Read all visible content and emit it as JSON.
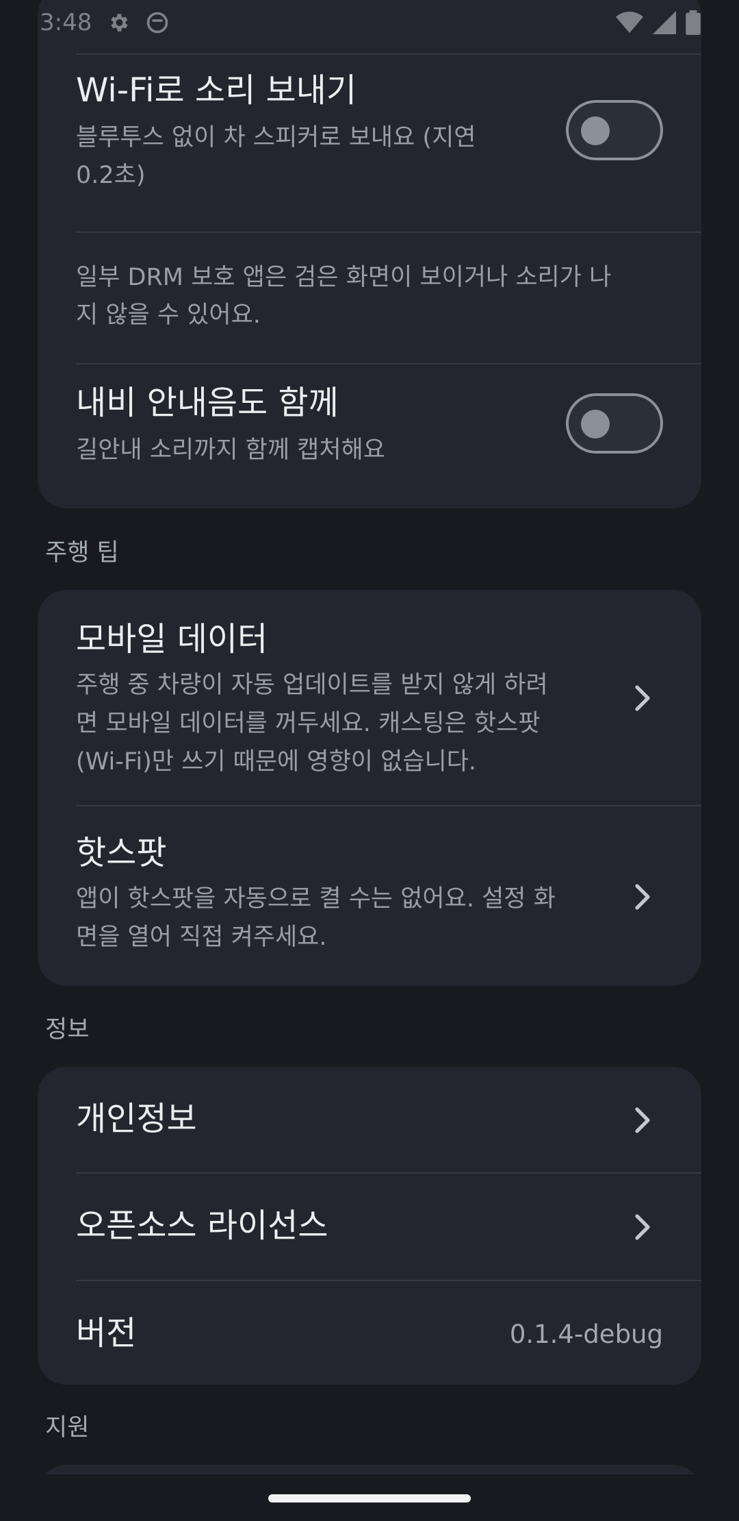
{
  "status_bar": {
    "time": "3:48",
    "icons": [
      "settings-gear-icon",
      "circle-face-icon",
      "wifi-icon",
      "signal-icon",
      "battery-icon"
    ]
  },
  "audio_card": {
    "wifi_audio": {
      "title": "Wi-Fi로 소리 보내기",
      "subtitle_line1": "블루투스 없이 차 스피커로 보내요 (지연",
      "subtitle_line2": "0.2초)",
      "enabled": false
    },
    "drm_note_line1": "일부 DRM 보호 앱은 검은 화면이 보이거나 소리가 나",
    "drm_note_line2": "지 않을 수 있어요.",
    "nav_audio": {
      "title": "내비 안내음도 함께",
      "subtitle": "길안내 소리까지 함께 캡처해요",
      "enabled": false
    }
  },
  "driving_tips": {
    "section_label": "주행 팁",
    "mobile_data": {
      "title": "모바일 데이터",
      "line1": "주행 중 차량이 자동 업데이트를 받지 않게 하려",
      "line2": "면 모바일 데이터를 꺼두세요. 캐스팅은 핫스팟",
      "line3": "(Wi-Fi)만 쓰기 때문에 영향이 없습니다."
    },
    "hotspot": {
      "title": "핫스팟",
      "line1": "앱이 핫스팟을 자동으로 켤 수는 없어요. 설정 화",
      "line2": "면을 열어 직접 켜주세요."
    }
  },
  "info": {
    "section_label": "정보",
    "privacy_label": "개인정보",
    "licenses_label": "오픈소스 라이선스",
    "version_label": "버전",
    "version_value": "0.1.4-debug"
  },
  "support": {
    "section_label": "지원"
  },
  "colors": {
    "background": "#181a20",
    "card": "#23262e",
    "divider": "#363a43",
    "toggle_off": "#8c9099"
  }
}
